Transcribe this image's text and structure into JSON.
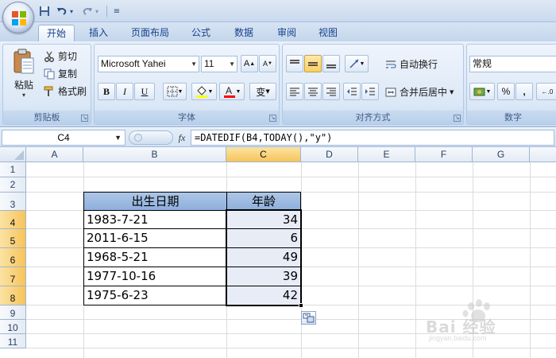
{
  "quick_access": {
    "dropdown_glyph": "▾"
  },
  "tabs": [
    {
      "label": "开始",
      "active": true
    },
    {
      "label": "插入"
    },
    {
      "label": "页面布局"
    },
    {
      "label": "公式"
    },
    {
      "label": "数据"
    },
    {
      "label": "审阅"
    },
    {
      "label": "视图"
    }
  ],
  "ribbon": {
    "clipboard": {
      "paste_label": "粘贴",
      "cut_label": "剪切",
      "copy_label": "复制",
      "format_painter_label": "格式刷",
      "group_label": "剪贴板"
    },
    "font": {
      "font_name": "Microsoft Yahei",
      "font_size": "11",
      "bold": "B",
      "italic": "I",
      "underline": "U",
      "group_label": "字体",
      "phonetic_label": "变"
    },
    "alignment": {
      "wrap_text_label": "自动换行",
      "merge_center_label": "合并后居中",
      "group_label": "对齐方式"
    },
    "number": {
      "format": "常规",
      "percent": "%",
      "comma": ",",
      "group_label": "数字"
    }
  },
  "formula_bar": {
    "name_box": "C4",
    "fx": "fx",
    "formula": "=DATEDIF(B4,TODAY(),\"y\")"
  },
  "sheet": {
    "columns": [
      "A",
      "B",
      "C",
      "D",
      "E",
      "F",
      "G"
    ],
    "selected_column": "C",
    "rows": [
      "1",
      "2",
      "3",
      "4",
      "5",
      "6",
      "7",
      "8",
      "9",
      "10",
      "11"
    ],
    "selected_rows": [
      "4",
      "5",
      "6",
      "7",
      "8"
    ],
    "table": {
      "headers": [
        "出生日期",
        "年龄"
      ],
      "rows": [
        {
          "birth": "1983-7-21",
          "age": "34"
        },
        {
          "birth": "2011-6-15",
          "age": "6"
        },
        {
          "birth": "1968-5-21",
          "age": "49"
        },
        {
          "birth": "1977-10-16",
          "age": "39"
        },
        {
          "birth": "1975-6-23",
          "age": "42"
        }
      ]
    }
  },
  "watermark": {
    "text": "Bai 经验",
    "subtext": "jingyan.baidu.com"
  },
  "colors": {
    "table_header": "#9bbbe3",
    "selection": "#f9cf63",
    "ribbon": "#dbe8f7"
  }
}
